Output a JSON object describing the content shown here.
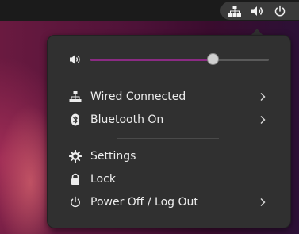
{
  "topbar": {
    "icons": [
      "network-wired-icon",
      "volume-icon",
      "power-icon"
    ]
  },
  "menu": {
    "volume": {
      "icon": "volume-icon",
      "level": 0.69
    },
    "items": [
      {
        "icon": "network-wired-icon",
        "label": "Wired Connected",
        "submenu": true
      },
      {
        "icon": "bluetooth-icon",
        "label": "Bluetooth On",
        "submenu": true
      },
      {
        "icon": "gear-icon",
        "label": "Settings",
        "submenu": false
      },
      {
        "icon": "lock-icon",
        "label": "Lock",
        "submenu": false
      },
      {
        "icon": "power-icon",
        "label": "Power Off / Log Out",
        "submenu": true
      }
    ]
  },
  "colors": {
    "accent": "#8b2b83",
    "menu_bg": "#303030",
    "topbar_bg": "#1b1b1b",
    "text": "#ececec"
  }
}
